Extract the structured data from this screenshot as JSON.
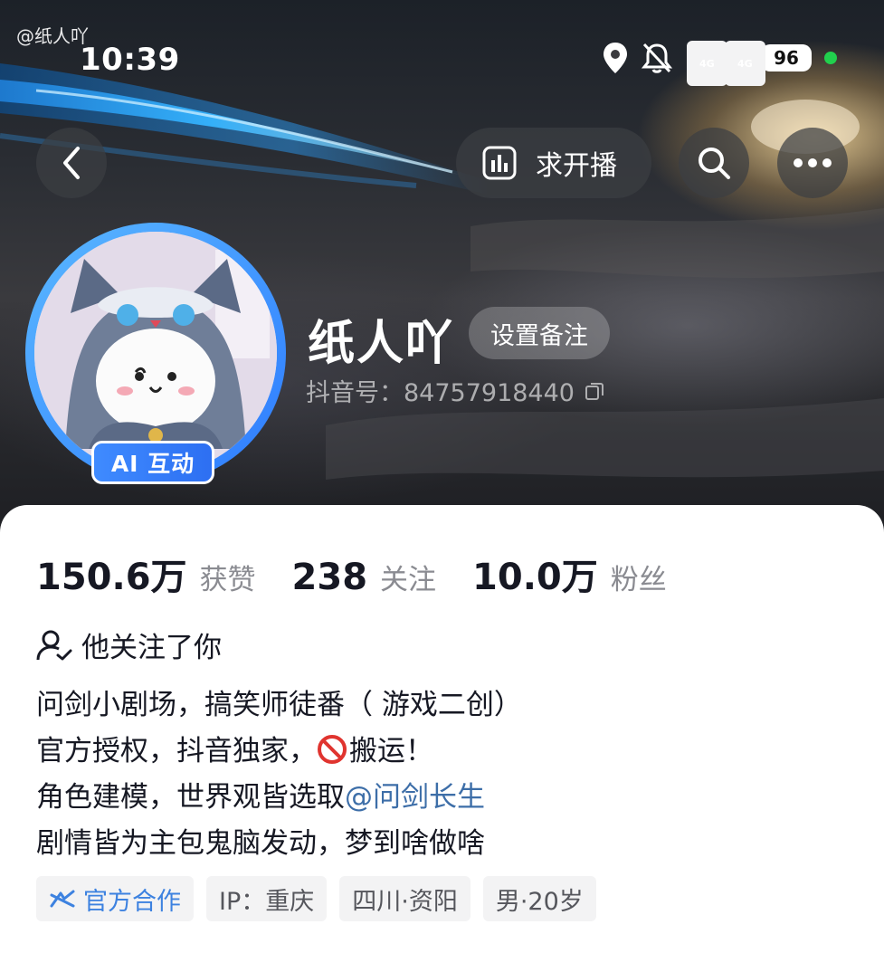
{
  "watermark": "@纸人吖",
  "status_bar": {
    "time": "10:39",
    "network_1": "4G",
    "network_2": "4G",
    "battery": "96",
    "icons": [
      "location-icon",
      "bell-muted-icon",
      "signal-icon",
      "signal-icon",
      "battery-icon",
      "active-dot-icon"
    ],
    "active_dot_color": "#21d04d"
  },
  "top_bar": {
    "back_icon": "chevron-left-icon",
    "live_request_label": "求开播",
    "live_request_icon": "bar-chart-icon",
    "search_icon": "search-icon",
    "more_icon": "more-horizontal-icon"
  },
  "profile": {
    "username": "纸人吖",
    "remark_button": "设置备注",
    "douyin_id": "抖音号：84757918440",
    "copy_icon": "copy-icon",
    "ai_badge": "AI 互动",
    "accent_color": "#2e7bff"
  },
  "stats": [
    {
      "value": "150.6万",
      "label": "获赞"
    },
    {
      "value": "238",
      "label": "关注"
    },
    {
      "value": "10.0万",
      "label": "粉丝"
    }
  ],
  "follow_note": "他关注了你",
  "bio": {
    "line1": "问剑小剧场，搞笑师徒番（ 游戏二创）",
    "line2_a": "官方授权，抖音独家，",
    "line2_b": "搬运！",
    "line3_a": "角色建模，世界观皆选取",
    "line3_mention": "@问剑长生",
    "line4": "剧情皆为主包鬼脑发动，梦到啥做啥",
    "mention_color": "#3d6ea8"
  },
  "tags": [
    {
      "label": "官方合作",
      "icon": "official-partner-icon"
    },
    {
      "label": "IP：重庆"
    },
    {
      "label": "四川·资阳"
    },
    {
      "label": "男·20岁"
    }
  ]
}
